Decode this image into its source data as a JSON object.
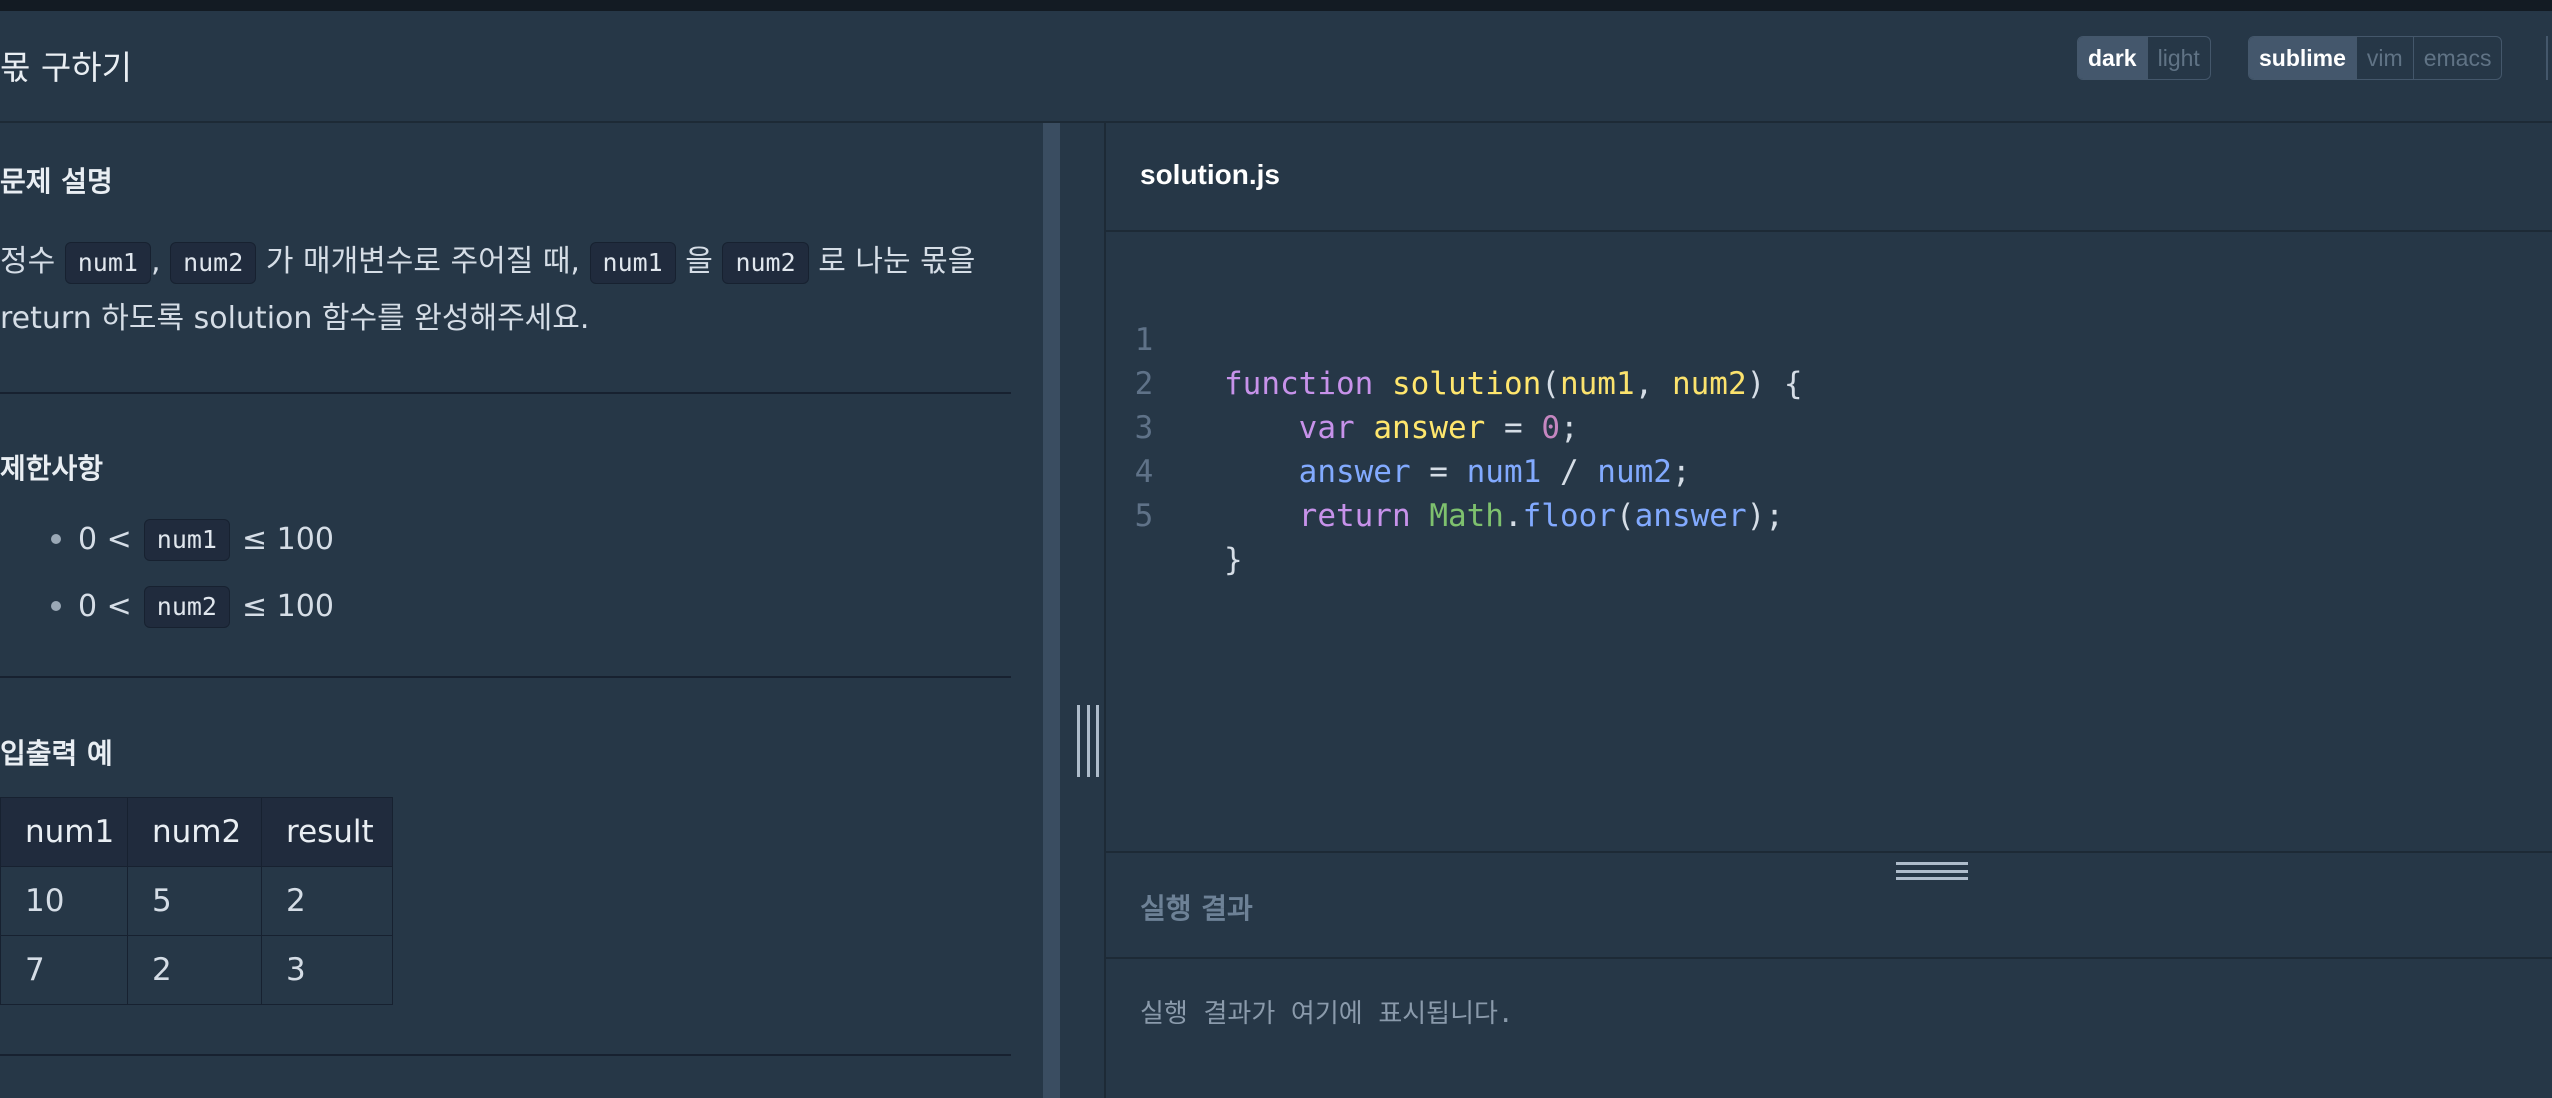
{
  "header": {
    "title": "몫 구하기",
    "theme_options": [
      "dark",
      "light"
    ],
    "theme_selected": "dark",
    "keymap_options": [
      "sublime",
      "vim",
      "emacs"
    ],
    "keymap_selected": "sublime"
  },
  "problem": {
    "description_heading": "문제 설명",
    "description": {
      "p1": "정수",
      "code1": "num1",
      "p2": ",",
      "code2": "num2",
      "p3": "가 매개변수로 주어질 때,",
      "code3": "num1",
      "p4": "을",
      "code4": "num2",
      "p5": "로 나눈 몫을 return 하도록 solution 함수를 완성해주세요."
    },
    "constraints_heading": "제한사항",
    "constraints": [
      {
        "pre": "0 <",
        "code": "num1",
        "post": "≤ 100"
      },
      {
        "pre": "0 <",
        "code": "num2",
        "post": "≤ 100"
      }
    ],
    "io_heading": "입출력 예",
    "io_table": {
      "headers": [
        "num1",
        "num2",
        "result"
      ],
      "rows": [
        [
          "10",
          "5",
          "2"
        ],
        [
          "7",
          "2",
          "3"
        ]
      ]
    }
  },
  "editor": {
    "filename": "solution.js",
    "line_numbers": [
      "1",
      "2",
      "3",
      "4",
      "5"
    ],
    "tokens": {
      "function_kw": "function",
      "fn_name": "solution",
      "param1": "num1",
      "param2": "num2",
      "var_kw": "var",
      "var_name": "answer",
      "zero": "0",
      "assign_target": "answer",
      "op_num1": "num1",
      "op_num2": "num2",
      "return_kw": "return",
      "math": "Math",
      "floor": "floor",
      "arg": "answer"
    }
  },
  "result": {
    "title": "실행 결과",
    "placeholder": "실행 결과가 여기에 표시됩니다."
  },
  "colors": {
    "background": "#263747",
    "active_toggle": "#44576c",
    "keyword": "#c792ea",
    "function_name": "#ffe66d",
    "identifier": "#82aaff",
    "class": "#7ec16e"
  }
}
